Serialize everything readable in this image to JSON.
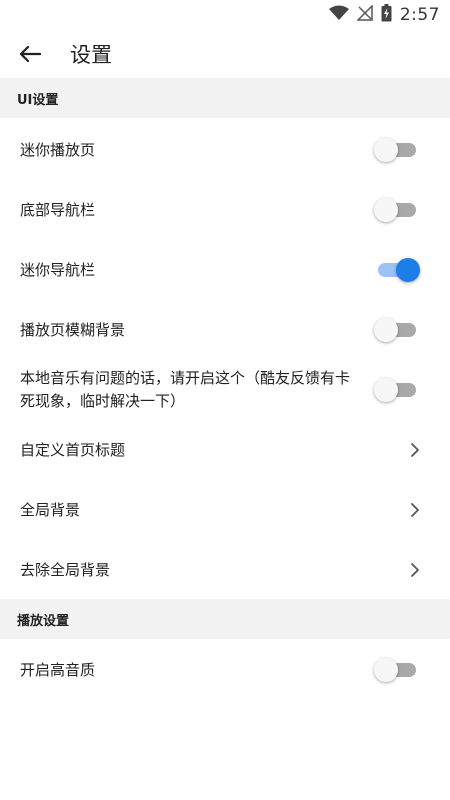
{
  "status_bar": {
    "time": "2:57"
  },
  "header": {
    "title": "设置"
  },
  "sections": [
    {
      "title": "UI设置"
    },
    {
      "title": "播放设置"
    }
  ],
  "settings": {
    "mini_player": {
      "label": "迷你播放页",
      "enabled": false
    },
    "bottom_nav": {
      "label": "底部导航栏",
      "enabled": false
    },
    "mini_nav": {
      "label": "迷你导航栏",
      "enabled": true
    },
    "blur_background": {
      "label": "播放页模糊背景",
      "enabled": false
    },
    "local_music_fix": {
      "label": "本地音乐有问题的话，请开启这个（酷友反馈有卡死现象，临时解决一下）",
      "enabled": false
    },
    "custom_home_title": {
      "label": "自定义首页标题"
    },
    "global_background": {
      "label": "全局背景"
    },
    "remove_global_background": {
      "label": "去除全局背景"
    },
    "high_quality": {
      "label": "开启高音质",
      "enabled": false
    }
  },
  "colors": {
    "accent": "#1d7ee8",
    "accent_track": "#9dc1f5",
    "section_bg": "#f2f2f2"
  }
}
